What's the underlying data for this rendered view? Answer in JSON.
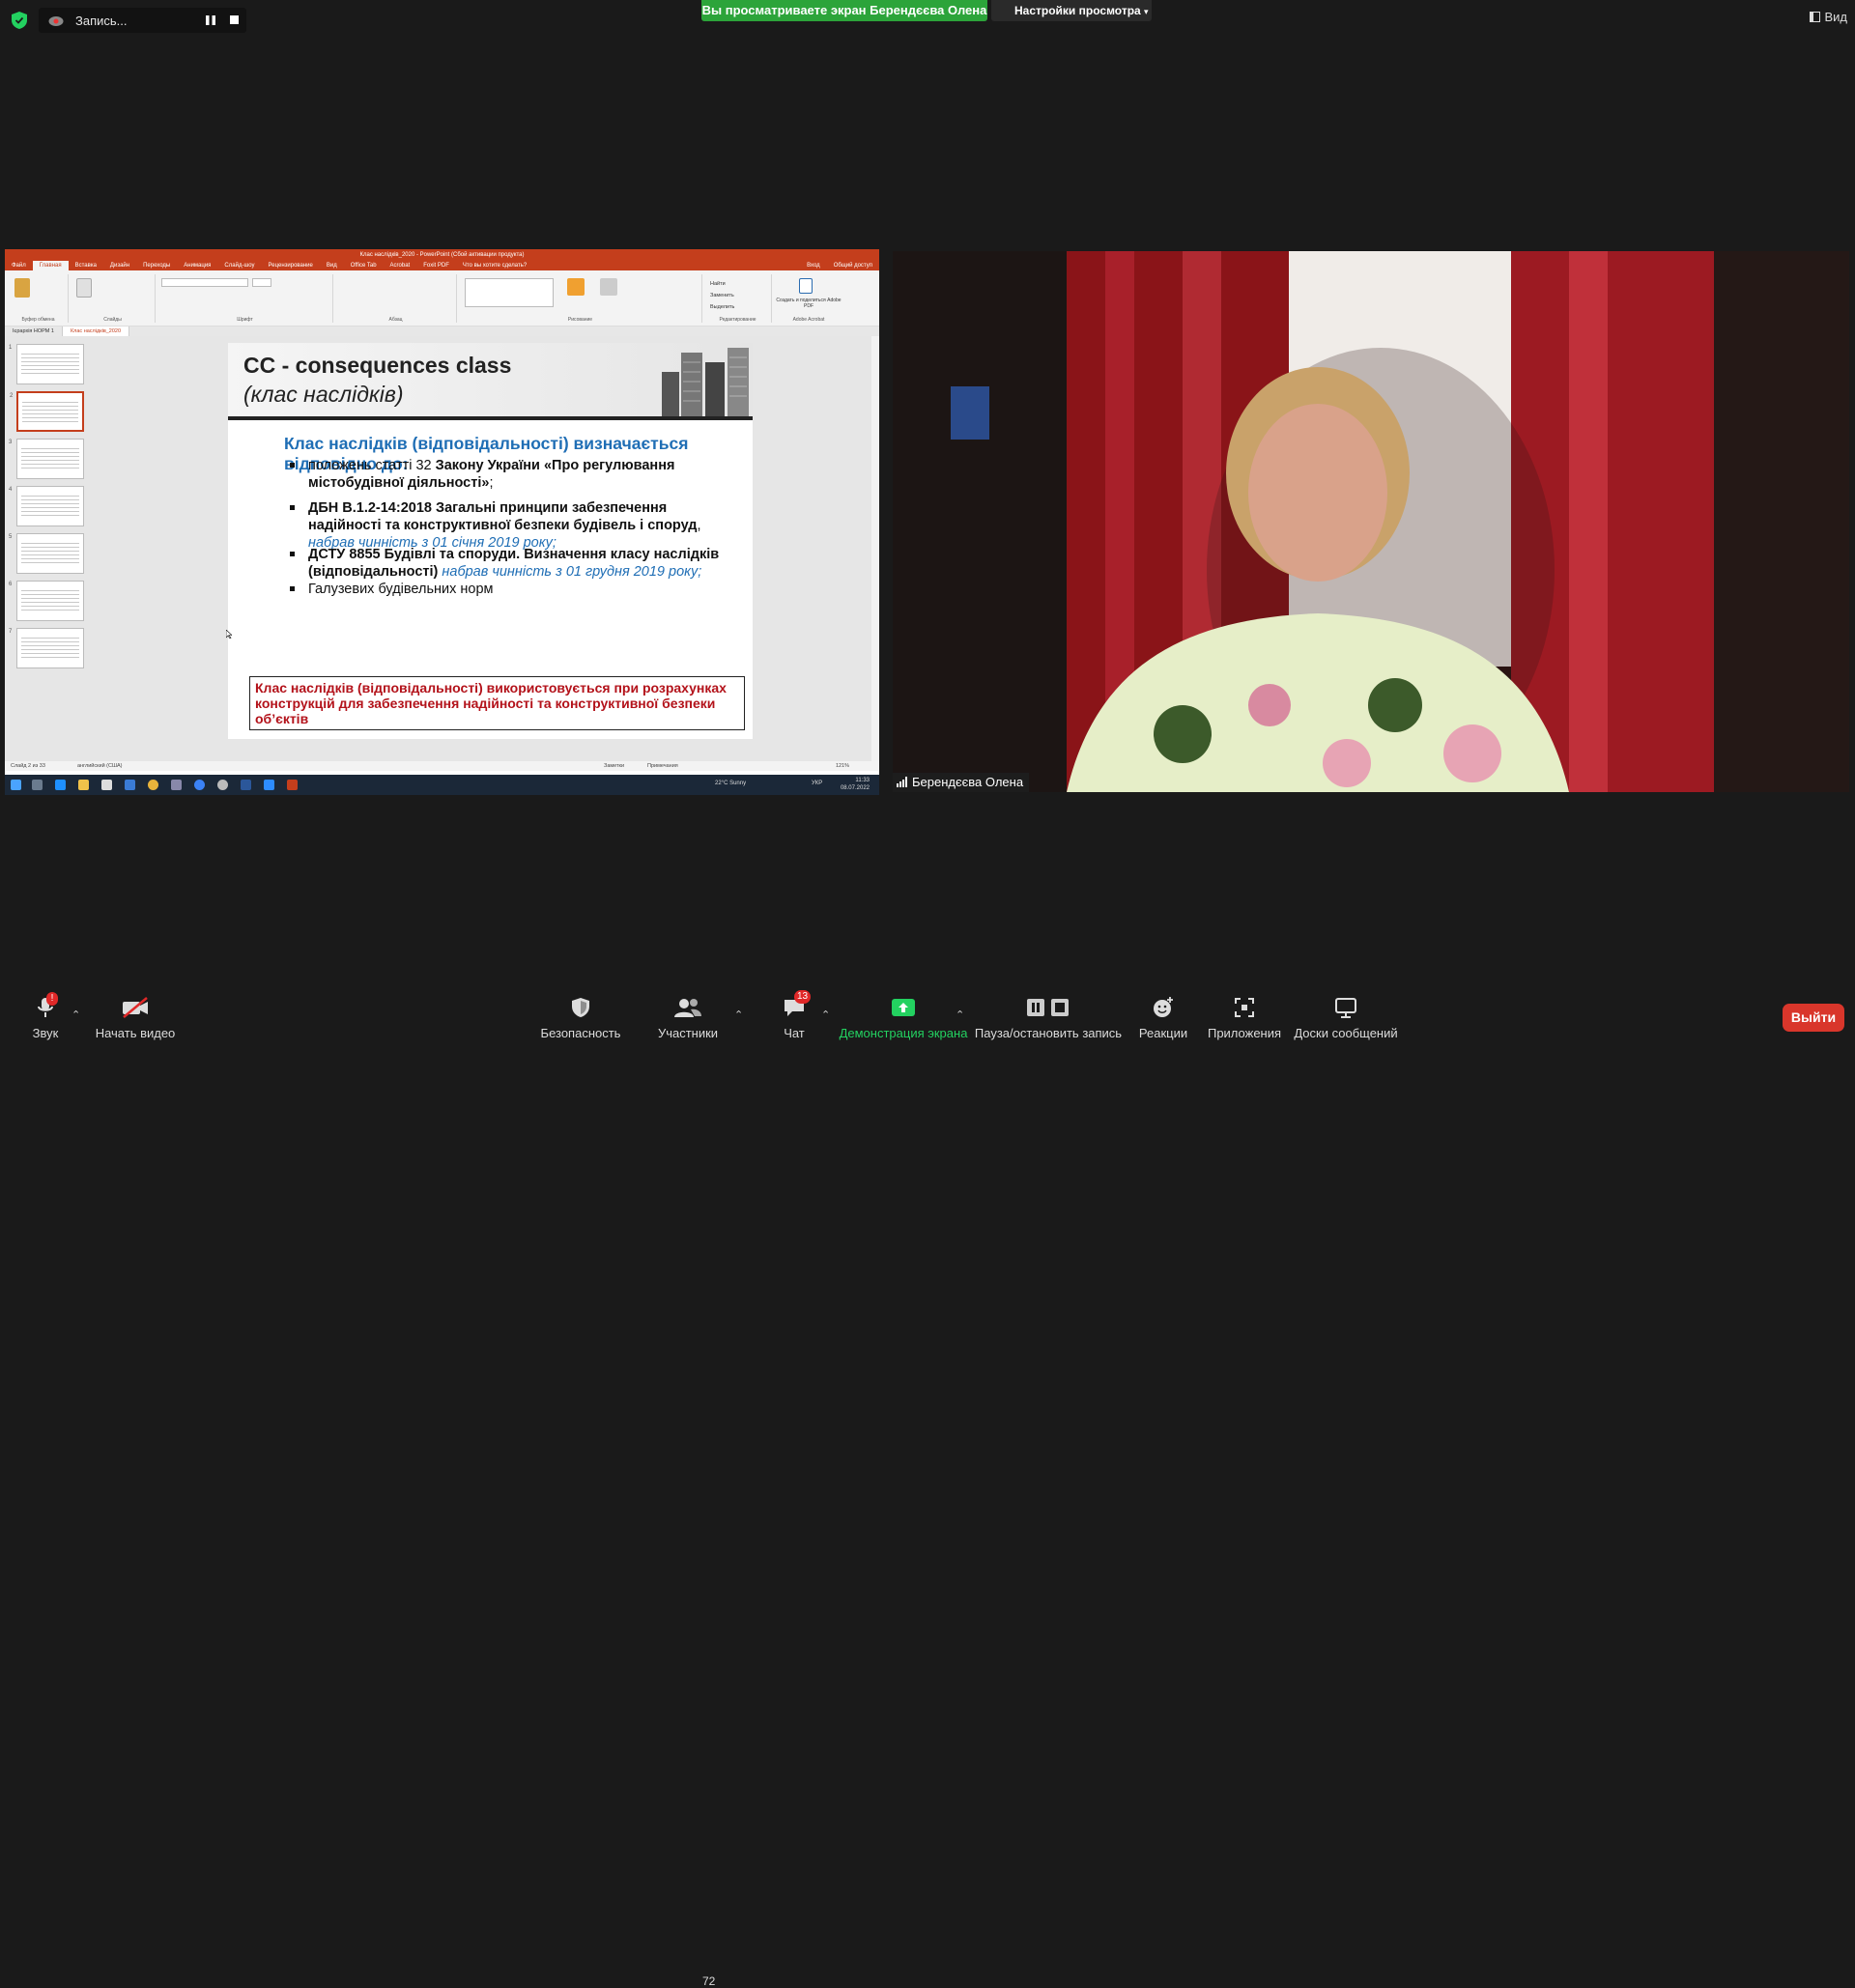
{
  "top": {
    "recording_label": "Запись...",
    "share_banner": "Вы просматриваете экран Берендєєва Олена",
    "view_options": "Настройки просмотра",
    "view_button": "Вид"
  },
  "powerpoint": {
    "title": "Клас наслідків_2020 - PowerPoint (Сбой активации продукта)",
    "tabs": [
      "Файл",
      "Главная",
      "Вставка",
      "Дизайн",
      "Переходы",
      "Анимация",
      "Слайд-шоу",
      "Рецензирование",
      "Вид",
      "Office Tab",
      "Acrobat",
      "Foxit PDF",
      "Что вы хотите сделать?"
    ],
    "active_tab": "Главная",
    "login": "Вход",
    "share": "Общий доступ",
    "ribbon_groups": [
      "Буфер обмена",
      "Слайды",
      "Шрифт",
      "Абзац",
      "Рисование",
      "Редактирование",
      "Adobe Acrobat"
    ],
    "ribbon_buttons": [
      "Вставить",
      "Создать слайд",
      "Макет",
      "Сбросить",
      "Раздел",
      "Упорядочить",
      "Экспресс-стили",
      "Заливка фигуры",
      "Контур фигуры",
      "Эффекты фигуры",
      "Найти",
      "Заменить",
      "Выделить",
      "Создать и поделиться Adobe PDF"
    ],
    "doc_tabs": [
      "Ієрархія НОРМ 1",
      "Клас наслідків_2020"
    ],
    "active_doc": "Клас наслідків_2020",
    "thumb_numbers": [
      "1",
      "2",
      "3",
      "4",
      "5",
      "6",
      "7"
    ],
    "status_left": "Слайд 2 из 33",
    "status_lang": "английский (США)",
    "status_notes": "Заметки",
    "status_comments": "Примечания",
    "zoom": "121%"
  },
  "slide": {
    "title": "CC - consequences class",
    "subtitle": "(клас наслідків)",
    "lead": "Клас наслідків (відповідальності) визначається відповідно до:",
    "bullets": [
      {
        "pre": "положень статті 32 ",
        "bold": "Закону України «Про регулювання містобудівної діяльності»",
        "post": ";",
        "italic": ""
      },
      {
        "pre": "",
        "bold": "ДБН В.1.2-14:2018 Загальні принципи забезпечення надійності та конструктивної безпеки будівель і споруд",
        "post": ", ",
        "italic": "набрав чинність з 01 січня 2019 року;"
      },
      {
        "pre": "",
        "bold": "ДСТУ 8855 Будівлі та споруди. Визначення класу наслідків (відповідальності)",
        "post": " ",
        "italic": "набрав чинність з 01 грудня 2019 року;"
      },
      {
        "pre": "Галузевих будівельних норм",
        "bold": "",
        "post": "",
        "italic": ""
      }
    ],
    "box": "Клас наслідків (відповідальності) використовується при розрахунках конструкцій для забезпечення надійності та конструктивної безпеки об’єктів"
  },
  "taskbar": {
    "weather": "22°C  Sunny",
    "lang": "УКР",
    "time": "11:33",
    "date": "08.07.2022"
  },
  "video": {
    "participant_name": "Берендєєва Олена"
  },
  "toolbar": {
    "audio": "Звук",
    "audio_badge": "!",
    "video": "Начать видео",
    "security": "Безопасность",
    "participants": "Участники",
    "participants_count": "72",
    "chat": "Чат",
    "chat_badge": "13",
    "share": "Демонстрация экрана",
    "record": "Пауза/остановить запись",
    "reactions": "Реакции",
    "apps": "Приложения",
    "whiteboards": "Доски сообщений",
    "leave": "Выйти"
  },
  "colors": {
    "zoom_green": "#23d160",
    "banner_green": "#2ca43a",
    "leave_red": "#d9362b",
    "pp_orange": "#c43e1c",
    "slide_blue": "#1f6eb5",
    "slide_red": "#b3121a"
  },
  "icons": [
    "shield-icon",
    "cloud-record-icon",
    "pause-icon",
    "stop-icon",
    "microphone-icon",
    "video-off-icon",
    "security-icon",
    "participants-icon",
    "chat-icon",
    "share-screen-icon",
    "record-pause-icon",
    "reactions-icon",
    "apps-icon",
    "whiteboard-icon",
    "signal-icon"
  ]
}
